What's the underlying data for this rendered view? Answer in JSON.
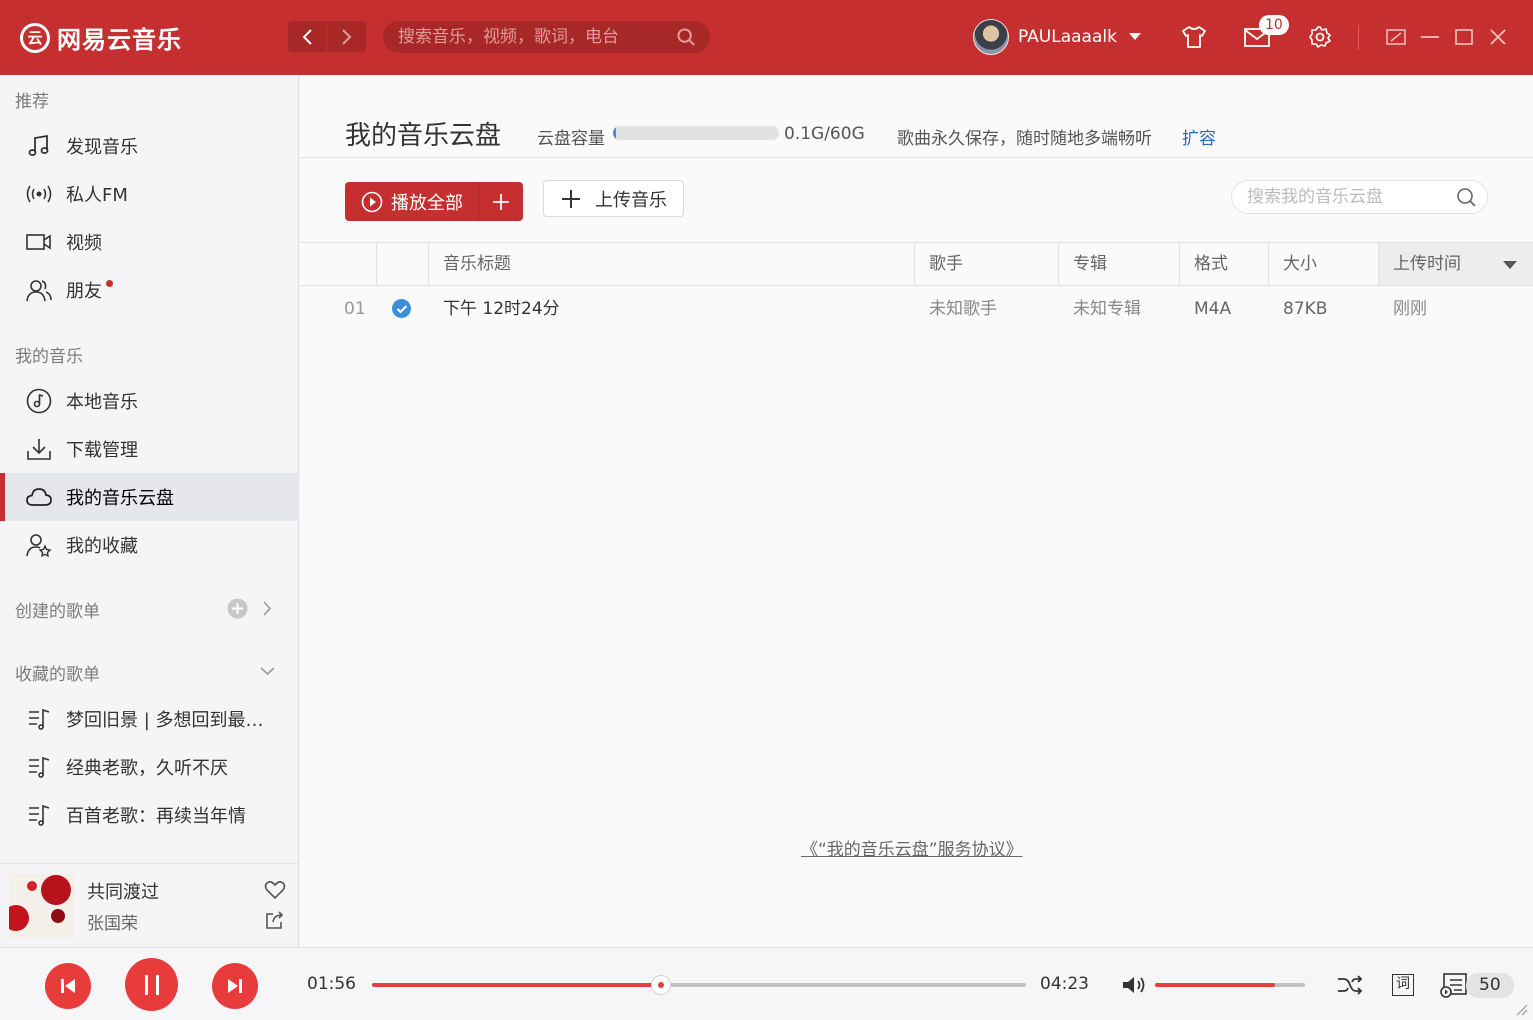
{
  "header": {
    "logo_mark": "云",
    "logo_text": "网易云音乐",
    "search_placeholder": "搜索音乐，视频，歌词，电台",
    "username": "PAULaaaalk",
    "message_count": "10"
  },
  "sidebar": {
    "recommend_title": "推荐",
    "recommend_items": [
      {
        "label": "发现音乐",
        "icon": "music-note-icon"
      },
      {
        "label": "私人FM",
        "icon": "radio-icon"
      },
      {
        "label": "视频",
        "icon": "video-icon"
      },
      {
        "label": "朋友",
        "icon": "friends-icon"
      }
    ],
    "my_music_title": "我的音乐",
    "my_music_items": [
      {
        "label": "本地音乐",
        "icon": "local-music-icon"
      },
      {
        "label": "下载管理",
        "icon": "download-icon"
      },
      {
        "label": "我的音乐云盘",
        "icon": "cloud-icon",
        "active": true
      },
      {
        "label": "我的收藏",
        "icon": "collection-icon"
      }
    ],
    "created_title": "创建的歌单",
    "collected_title": "收藏的歌单",
    "playlists": [
      {
        "label": "梦回旧景 | 多想回到最初的模样"
      },
      {
        "label": "经典老歌，久听不厌"
      },
      {
        "label": "百首老歌：再续当年情"
      }
    ]
  },
  "now_playing": {
    "song": "共同渡过",
    "artist": "张国荣"
  },
  "main": {
    "title": "我的音乐云盘",
    "capacity_label": "云盘容量",
    "capacity_fraction": 0.002,
    "capacity_value": "0.1G/60G",
    "note": "歌曲永久保存，随时随地多端畅听",
    "expand_label": "扩容",
    "play_all_label": "播放全部",
    "upload_label": "上传音乐",
    "search_placeholder": "搜索我的音乐云盘",
    "columns": [
      "音乐标题",
      "歌手",
      "专辑",
      "格式",
      "大小",
      "上传时间"
    ],
    "rows": [
      {
        "index": "01",
        "title": "下午 12时24分",
        "artist": "未知歌手",
        "album": "未知专辑",
        "format": "M4A",
        "size": "87KB",
        "uploaded": "刚刚"
      }
    ],
    "agreement": "《“我的音乐云盘”服务协议》"
  },
  "player": {
    "elapsed": "01:56",
    "total": "04:23",
    "progress": 0.442,
    "volume": 0.8,
    "lyrics_label": "词",
    "playlist_count": "50"
  },
  "colors": {
    "brand": "#c62f2f",
    "accent": "#e83c3c",
    "link": "#2e69b7"
  }
}
